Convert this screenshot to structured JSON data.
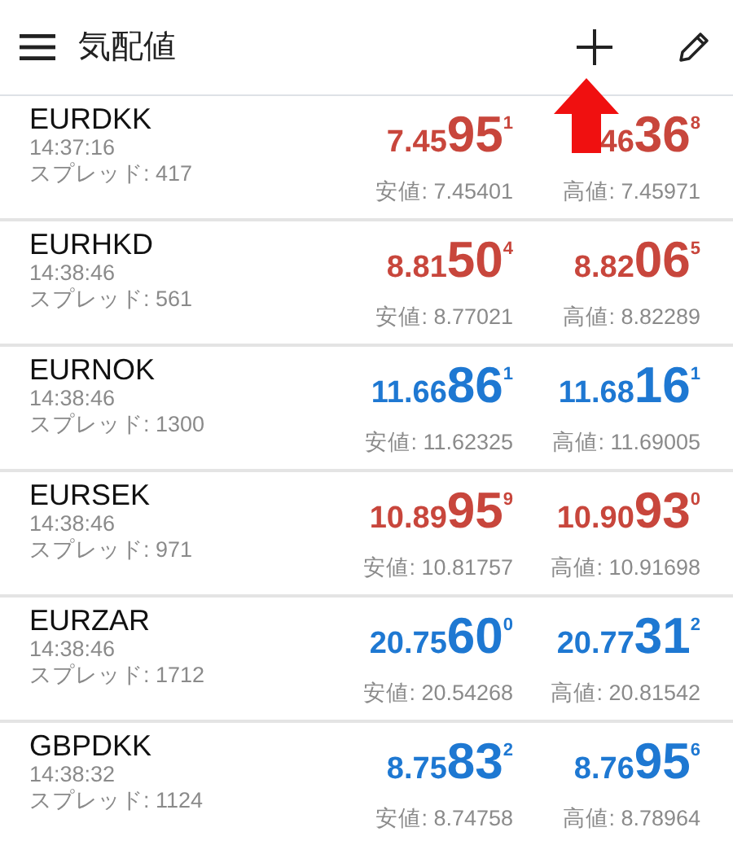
{
  "header": {
    "title": "気配値"
  },
  "quotes": [
    {
      "symbol": "EURDKK",
      "time": "14:37:16",
      "spread": "スプレッド: 417",
      "color": "#c8463c",
      "bid": {
        "small": "7.45",
        "big": "95",
        "sup": "1"
      },
      "ask": {
        "small": "46",
        "big": "36",
        "sup": "8"
      },
      "low": "安値: 7.45401",
      "high": "高値: 7.45971"
    },
    {
      "symbol": "EURHKD",
      "time": "14:38:46",
      "spread": "スプレッド: 561",
      "color": "#c8463c",
      "bid": {
        "small": "8.81",
        "big": "50",
        "sup": "4"
      },
      "ask": {
        "small": "8.82",
        "big": "06",
        "sup": "5"
      },
      "low": "安値: 8.77021",
      "high": "高値: 8.82289"
    },
    {
      "symbol": "EURNOK",
      "time": "14:38:46",
      "spread": "スプレッド: 1300",
      "color": "#1e78d2",
      "bid": {
        "small": "11.66",
        "big": "86",
        "sup": "1"
      },
      "ask": {
        "small": "11.68",
        "big": "16",
        "sup": "1"
      },
      "low": "安値: 11.62325",
      "high": "高値: 11.69005"
    },
    {
      "symbol": "EURSEK",
      "time": "14:38:46",
      "spread": "スプレッド: 971",
      "color": "#c8463c",
      "bid": {
        "small": "10.89",
        "big": "95",
        "sup": "9"
      },
      "ask": {
        "small": "10.90",
        "big": "93",
        "sup": "0"
      },
      "low": "安値: 10.81757",
      "high": "高値: 10.91698"
    },
    {
      "symbol": "EURZAR",
      "time": "14:38:46",
      "spread": "スプレッド: 1712",
      "color": "#1e78d2",
      "bid": {
        "small": "20.75",
        "big": "60",
        "sup": "0"
      },
      "ask": {
        "small": "20.77",
        "big": "31",
        "sup": "2"
      },
      "low": "安値: 20.54268",
      "high": "高値: 20.81542"
    },
    {
      "symbol": "GBPDKK",
      "time": "14:38:32",
      "spread": "スプレッド: 1124",
      "color": "#1e78d2",
      "bid": {
        "small": "8.75",
        "big": "83",
        "sup": "2"
      },
      "ask": {
        "small": "8.76",
        "big": "95",
        "sup": "6"
      },
      "low": "安値: 8.74758",
      "high": "高値: 8.78964"
    }
  ]
}
